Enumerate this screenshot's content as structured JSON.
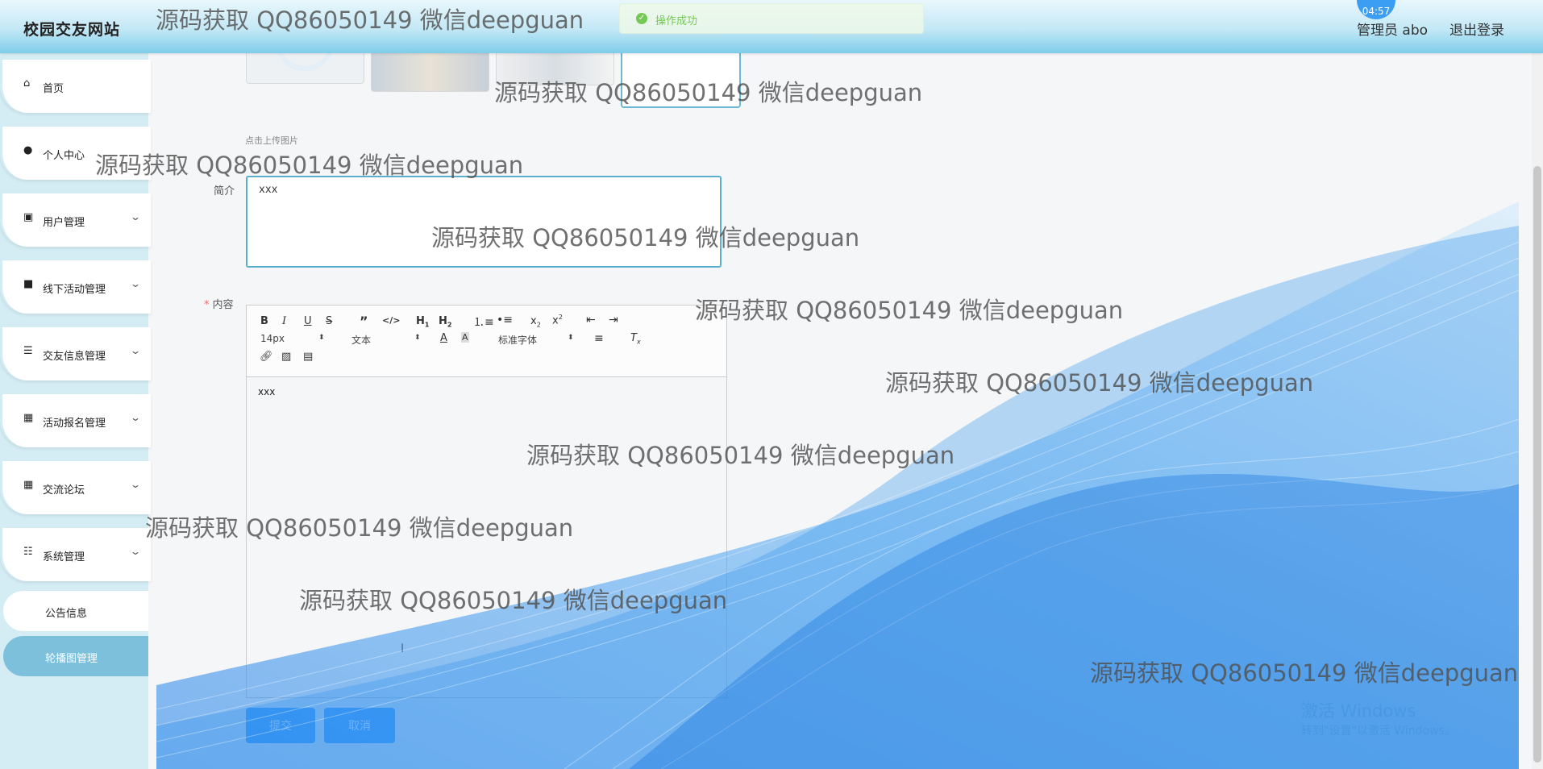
{
  "header": {
    "site_title": "校园交友网站",
    "admin_label": "管理员 abo",
    "logout_label": "退出登录",
    "time_badge": "04:57"
  },
  "toast": {
    "message": "操作成功"
  },
  "sidebar": {
    "items": [
      {
        "label": "首页",
        "icon": "home-icon"
      },
      {
        "label": "个人中心",
        "icon": "user-icon"
      },
      {
        "label": "用户管理",
        "icon": "clipboard-icon"
      },
      {
        "label": "线下活动管理",
        "icon": "briefcase-icon"
      },
      {
        "label": "交友信息管理",
        "icon": "list-icon"
      },
      {
        "label": "活动报名管理",
        "icon": "grid-icon"
      },
      {
        "label": "交流论坛",
        "icon": "grid-icon"
      },
      {
        "label": "系统管理",
        "icon": "sliders-icon"
      }
    ],
    "sub_items": [
      {
        "label": "公告信息",
        "active": false
      },
      {
        "label": "轮播图管理",
        "active": true
      }
    ]
  },
  "form": {
    "upload_hint": "点击上传图片",
    "intro_label": "简介",
    "intro_value": "xxx",
    "content_label": "内容",
    "content_required_mark": "*",
    "editor": {
      "font_size": "14px",
      "text_type": "文本",
      "font_family": "标准字体",
      "content": "xxx"
    },
    "submit_label": "提交",
    "cancel_label": "取消"
  },
  "watermark": "源码获取 QQ86050149 微信deepguan",
  "windows_activation": {
    "title": "激活 Windows",
    "subtitle": "转到\"设置\"以激活 Windows。"
  },
  "colors": {
    "accent": "#409eff",
    "sidebar_active": "#7cc0dc",
    "header": "#7fcde9",
    "success": "#67c23a"
  }
}
